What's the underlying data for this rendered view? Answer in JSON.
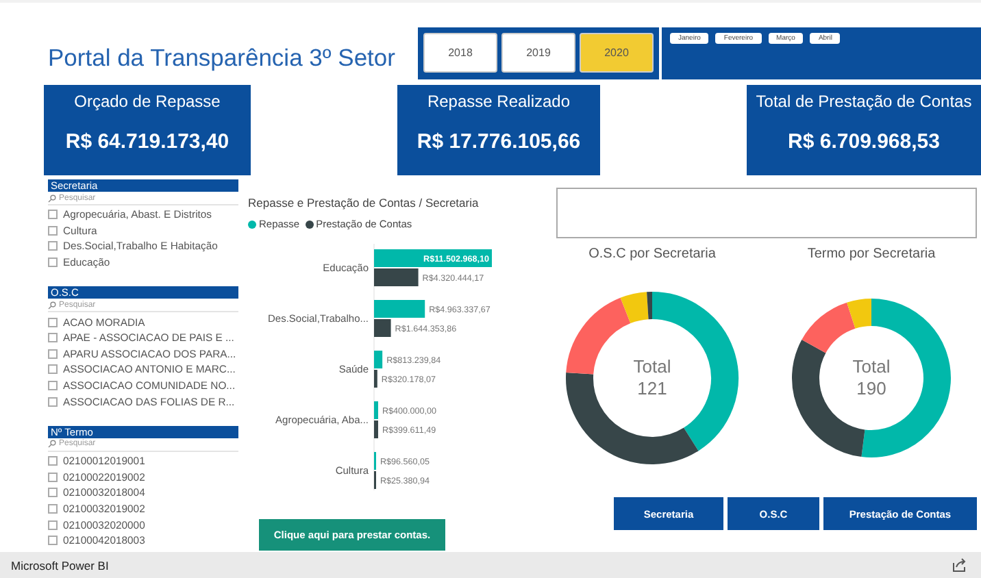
{
  "header": {
    "title": "Portal da Transparência 3º Setor"
  },
  "years": [
    {
      "label": "2018",
      "selected": false
    },
    {
      "label": "2019",
      "selected": false
    },
    {
      "label": "2020",
      "selected": true
    }
  ],
  "months": [
    "Janeiro",
    "Fevereiro",
    "Março",
    "Abril"
  ],
  "kpis": [
    {
      "title": "Orçado de Repasse",
      "value": "R$ 64.719.173,40"
    },
    {
      "title": "Repasse Realizado",
      "value": "R$ 17.776.105,66"
    },
    {
      "title": "Total de Prestação de Contas",
      "value": "R$ 6.709.968,53"
    }
  ],
  "slicers": [
    {
      "title": "Secretaria",
      "placeholder": "Pesquisar",
      "items": [
        {
          "label": "Agropecuária, Abast. E Distritos",
          "checked": false
        },
        {
          "label": "Cultura",
          "checked": false
        },
        {
          "label": "Des.Social,Trabalho E Habitação",
          "checked": false
        },
        {
          "label": "Educação",
          "checked": false
        }
      ]
    },
    {
      "title": "O.S.C",
      "placeholder": "Pesquisar",
      "items": [
        {
          "label": "ACAO MORADIA",
          "checked": false
        },
        {
          "label": "APAE - ASSOCIACAO DE PAIS E ...",
          "checked": false
        },
        {
          "label": "APARU ASSOCIACAO DOS PARA...",
          "checked": false
        },
        {
          "label": "ASSOCIACAO ANTONIO E MARC...",
          "checked": false
        },
        {
          "label": "ASSOCIACAO COMUNIDADE NO...",
          "checked": false
        },
        {
          "label": "ASSOCIACAO DAS FOLIAS DE R...",
          "checked": false
        }
      ]
    },
    {
      "title": "Nº Termo",
      "placeholder": "Pesquisar",
      "items": [
        {
          "label": "02100012019001",
          "checked": false
        },
        {
          "label": "02100022019002",
          "checked": false
        },
        {
          "label": "02100032018004",
          "checked": false
        },
        {
          "label": "02100032019002",
          "checked": false
        },
        {
          "label": "02100032020000",
          "checked": false
        },
        {
          "label": "02100042018003",
          "checked": false
        }
      ]
    }
  ],
  "bar_chart": {
    "chart_data": {
      "type": "bar",
      "title": "Repasse e Prestação de Contas / Secretaria",
      "orientation": "horizontal",
      "categories": [
        "Educação",
        "Des.Social,Trabalho...",
        "Saúde",
        "Agropecuária, Aba...",
        "Cultura"
      ],
      "series": [
        {
          "name": "Repasse",
          "color": "#01b8aa",
          "values": [
            11502968.1,
            4963337.67,
            813239.84,
            400000.0,
            96560.05
          ],
          "value_labels": [
            "R$11.502.968,10",
            "R$4.963.337,67",
            "R$813.239,84",
            "R$400.000,00",
            "R$96.560,05"
          ]
        },
        {
          "name": "Prestação de Contas",
          "color": "#374649",
          "values": [
            4320444.17,
            1644353.86,
            320178.07,
            399611.49,
            25380.94
          ],
          "value_labels": [
            "R$4.320.444,17",
            "R$1.644.353,86",
            "R$320.178,07",
            "R$399.611,49",
            "R$25.380,94"
          ]
        }
      ]
    }
  },
  "action_button": {
    "label": "Clique aqui para prestar contas."
  },
  "donuts": [
    {
      "title": "O.S.C por Secretaria",
      "total_label": "Total",
      "total": "121"
    },
    {
      "title": "Termo por Secretaria",
      "total_label": "Total",
      "total": "190"
    }
  ],
  "nav_buttons": [
    "Secretaria",
    "O.S.C",
    "Prestação de Contas"
  ],
  "status_bar": {
    "app_name": "Microsoft Power BI"
  }
}
